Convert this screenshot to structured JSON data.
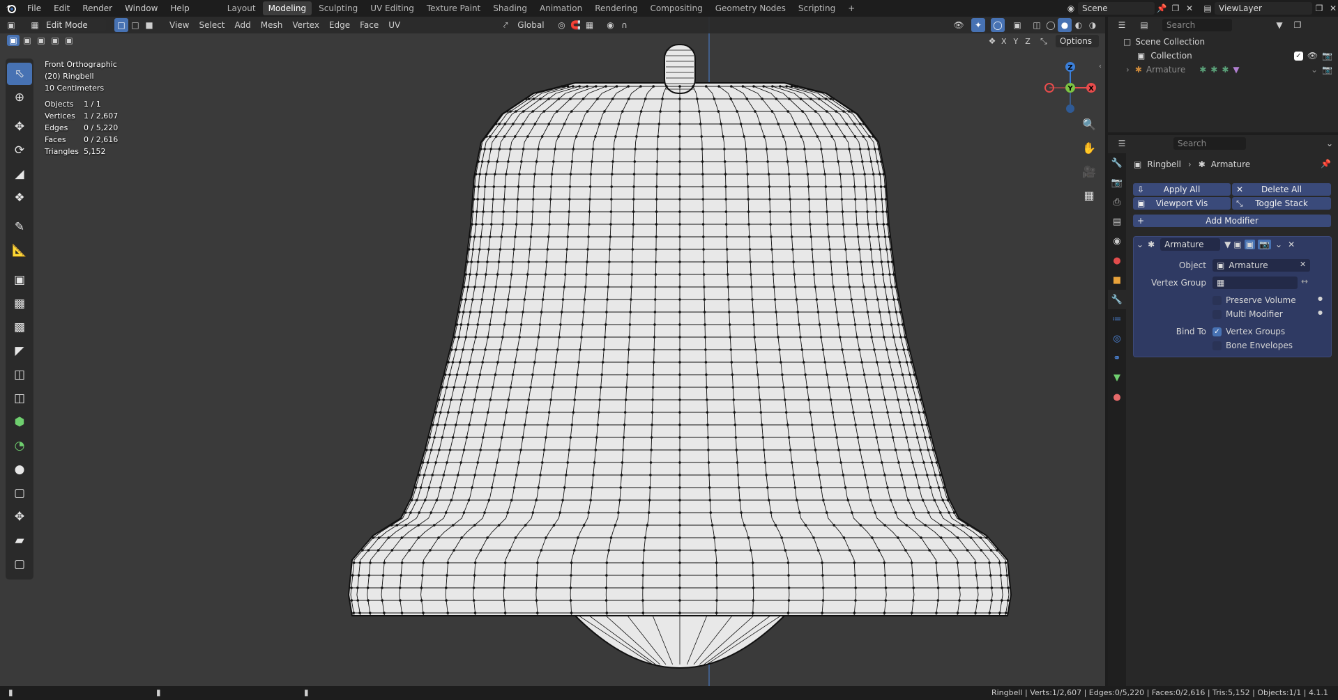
{
  "menu": {
    "blender_logo": "blender-logo",
    "items": [
      "File",
      "Edit",
      "Render",
      "Window",
      "Help"
    ],
    "workspaces": [
      "Layout",
      "Modeling",
      "Sculpting",
      "UV Editing",
      "Texture Paint",
      "Shading",
      "Animation",
      "Rendering",
      "Compositing",
      "Geometry Nodes",
      "Scripting"
    ],
    "active_workspace": "Modeling",
    "add_tab": "+",
    "scene_label": "Scene",
    "view_layer_label": "ViewLayer"
  },
  "viewport": {
    "mode": "Edit Mode",
    "menus": [
      "View",
      "Select",
      "Add",
      "Mesh",
      "Vertex",
      "Edge",
      "Face",
      "UV"
    ],
    "orientation": "Global",
    "options": "Options",
    "axis_x": "X",
    "axis_y": "Y",
    "axis_z": "Z",
    "view_name": "Front Orthographic",
    "object_name": "(20) Ringbell",
    "scale": "10 Centimeters",
    "stats": [
      {
        "label": "Objects",
        "value": "1 / 1"
      },
      {
        "label": "Vertices",
        "value": "1 / 2,607"
      },
      {
        "label": "Edges",
        "value": "0 / 5,220"
      },
      {
        "label": "Faces",
        "value": "0 / 2,616"
      },
      {
        "label": "Triangles",
        "value": "5,152"
      }
    ],
    "background": "#3a3a3a",
    "mesh_fill": "#e8e8e8",
    "mesh_wire": "#111111"
  },
  "outliner": {
    "search_placeholder": "Search",
    "scene_collection": "Scene Collection",
    "collection": "Collection",
    "armature": "Armature"
  },
  "properties": {
    "search_placeholder": "Search",
    "breadcrumb_object": "Ringbell",
    "breadcrumb_modifier": "Armature",
    "apply_all": "Apply All",
    "delete_all": "Delete All",
    "viewport_vis": "Viewport Vis",
    "toggle_stack": "Toggle Stack",
    "add_modifier": "Add Modifier",
    "modifier_name": "Armature",
    "object_label": "Object",
    "object_value": "Armature",
    "vertex_group_label": "Vertex Group",
    "vertex_group_value": "",
    "preserve_volume": "Preserve Volume",
    "multi_modifier": "Multi Modifier",
    "bind_to_label": "Bind To",
    "vertex_groups": "Vertex Groups",
    "bone_envelopes": "Bone Envelopes",
    "accent": "#4772b3"
  },
  "status": {
    "text": "Ringbell | Verts:1/2,607 | Edges:0/5,220 | Faces:0/2,616 | Tris:5,152 | Objects:1/1 | 4.1.1"
  }
}
